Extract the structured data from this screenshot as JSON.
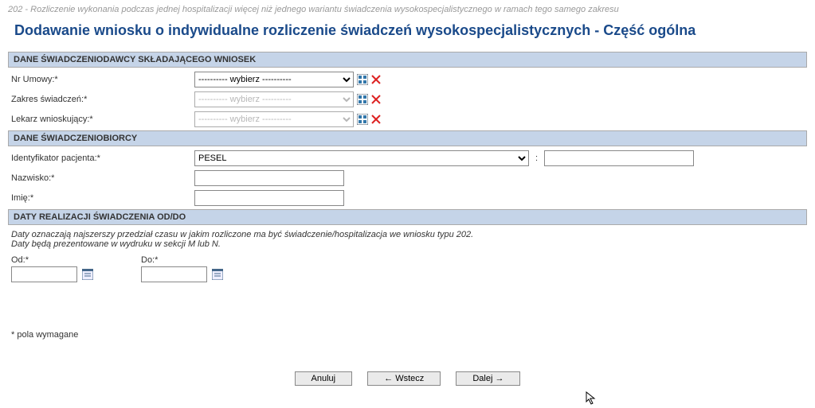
{
  "breadcrumb": "202 - Rozliczenie wykonania podczas jednej hospitalizacji więcej niż jednego wariantu świadczenia wysokospecjalistycznego w ramach tego samego zakresu",
  "title": "Dodawanie wniosku o indywidualne rozliczenie świadczeń wysokospecjalistycznych - Część ogólna",
  "sections": {
    "provider": {
      "header": "DANE ŚWIADCZENIODAWCY SKŁADAJĄCEGO WNIOSEK",
      "fields": {
        "umowa": {
          "label": "Nr Umowy:*",
          "placeholder": "---------- wybierz ----------"
        },
        "zakres": {
          "label": "Zakres świadczeń:*",
          "placeholder": "---------- wybierz ----------"
        },
        "lekarz": {
          "label": "Lekarz wnioskujący:*",
          "placeholder": "---------- wybierz ----------"
        }
      }
    },
    "recipient": {
      "header": "DANE ŚWIADCZENIOBIORCY",
      "fields": {
        "ident": {
          "label": "Identyfikator pacjenta:*",
          "value": "PESEL"
        },
        "nazwisko": {
          "label": "Nazwisko:*"
        },
        "imie": {
          "label": "Imię:*"
        }
      }
    },
    "dates": {
      "header": "DATY REALIZACJI ŚWIADCZENIA OD/DO",
      "note_line1": "Daty oznaczają najszerszy przedział czasu w jakim rozliczone ma być świadczenie/hospitalizacja we wniosku typu 202.",
      "note_line2": "Daty będą prezentowane w wydruku w sekcji M lub N.",
      "od_label": "Od:*",
      "do_label": "Do:*"
    }
  },
  "required_note": "* pola wymagane",
  "buttons": {
    "cancel": "Anuluj",
    "back": "← Wstecz",
    "next": "Dalej →"
  }
}
